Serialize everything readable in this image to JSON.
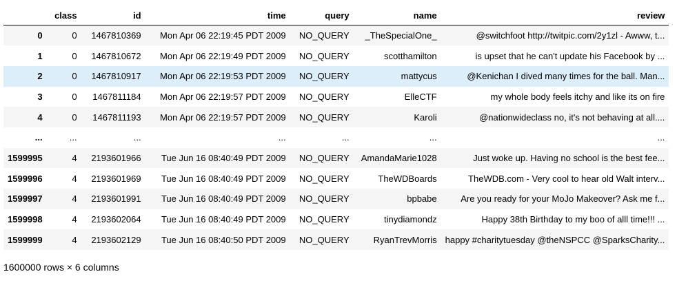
{
  "table": {
    "columns": [
      "",
      "class",
      "id",
      "time",
      "query",
      "name",
      "review"
    ],
    "rows": [
      {
        "index": "0",
        "class": "0",
        "id": "1467810369",
        "time": "Mon Apr 06 22:19:45 PDT 2009",
        "query": "NO_QUERY",
        "name": "_TheSpecialOne_",
        "review": "@switchfoot http://twitpic.com/2y1zl - Awww, t..."
      },
      {
        "index": "1",
        "class": "0",
        "id": "1467810672",
        "time": "Mon Apr 06 22:19:49 PDT 2009",
        "query": "NO_QUERY",
        "name": "scotthamilton",
        "review": "is upset that he can't update his Facebook by ..."
      },
      {
        "index": "2",
        "class": "0",
        "id": "1467810917",
        "time": "Mon Apr 06 22:19:53 PDT 2009",
        "query": "NO_QUERY",
        "name": "mattycus",
        "review": "@Kenichan I dived many times for the ball. Man...",
        "highlighted": true
      },
      {
        "index": "3",
        "class": "0",
        "id": "1467811184",
        "time": "Mon Apr 06 22:19:57 PDT 2009",
        "query": "NO_QUERY",
        "name": "ElleCTF",
        "review": "my whole body feels itchy and like its on fire"
      },
      {
        "index": "4",
        "class": "0",
        "id": "1467811193",
        "time": "Mon Apr 06 22:19:57 PDT 2009",
        "query": "NO_QUERY",
        "name": "Karoli",
        "review": "@nationwideclass no, it's not behaving at all...."
      },
      {
        "index": "...",
        "class": "...",
        "id": "...",
        "time": "...",
        "query": "...",
        "name": "...",
        "review": "..."
      },
      {
        "index": "1599995",
        "class": "4",
        "id": "2193601966",
        "time": "Tue Jun 16 08:40:49 PDT 2009",
        "query": "NO_QUERY",
        "name": "AmandaMarie1028",
        "review": "Just woke up. Having no school is the best fee..."
      },
      {
        "index": "1599996",
        "class": "4",
        "id": "2193601969",
        "time": "Tue Jun 16 08:40:49 PDT 2009",
        "query": "NO_QUERY",
        "name": "TheWDBoards",
        "review": "TheWDB.com - Very cool to hear old Walt interv..."
      },
      {
        "index": "1599997",
        "class": "4",
        "id": "2193601991",
        "time": "Tue Jun 16 08:40:49 PDT 2009",
        "query": "NO_QUERY",
        "name": "bpbabe",
        "review": "Are you ready for your MoJo Makeover? Ask me f..."
      },
      {
        "index": "1599998",
        "class": "4",
        "id": "2193602064",
        "time": "Tue Jun 16 08:40:49 PDT 2009",
        "query": "NO_QUERY",
        "name": "tinydiamondz",
        "review": "Happy 38th Birthday to my boo of alll time!!! ..."
      },
      {
        "index": "1599999",
        "class": "4",
        "id": "2193602129",
        "time": "Tue Jun 16 08:40:50 PDT 2009",
        "query": "NO_QUERY",
        "name": "RyanTrevMorris",
        "review": "happy #charitytuesday @theNSPCC @SparksCharity..."
      }
    ]
  },
  "shape_text": "1600000 rows × 6 columns",
  "colors": {
    "row_odd": "#f5f5f5",
    "row_even": "#ffffff",
    "row_highlight": "#ddeefb"
  }
}
